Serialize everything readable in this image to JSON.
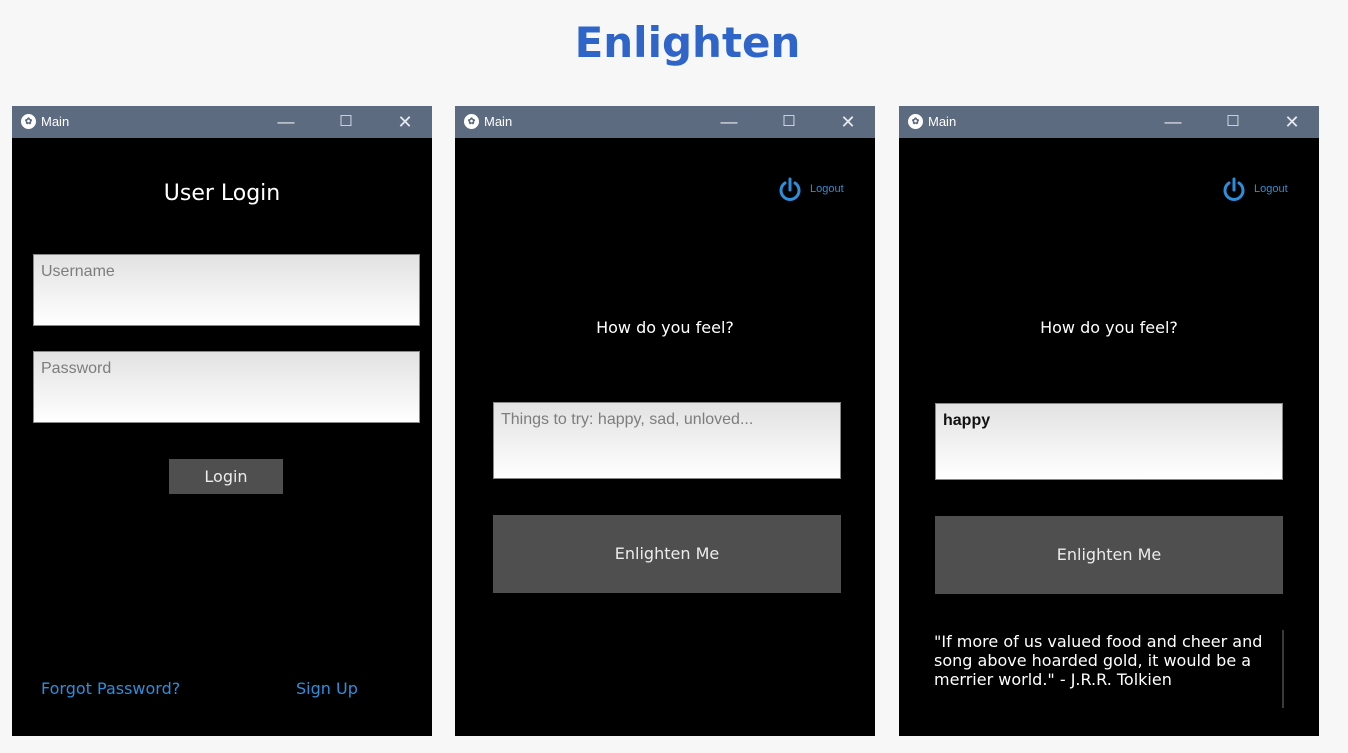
{
  "page": {
    "title": "Enlighten"
  },
  "windows": {
    "login": {
      "title": "Main",
      "heading": "User Login",
      "username_placeholder": "Username",
      "password_placeholder": "Password",
      "login_button": "Login",
      "forgot_link": "Forgot Password?",
      "signup_link": "Sign Up"
    },
    "ask": {
      "title": "Main",
      "logout_label": "Logout",
      "prompt": "How do you feel?",
      "input_placeholder": "Things to try: happy, sad, unloved...",
      "button": "Enlighten Me"
    },
    "result": {
      "title": "Main",
      "logout_label": "Logout",
      "prompt": "How do you feel?",
      "input_value": "happy",
      "button": "Enlighten Me",
      "quote": "\"If more of us valued food and cheer and song above hoarded gold, it would be a merrier world.\" - J.R.R. Tolkien"
    }
  },
  "icons": {
    "app": "kivy-app-icon",
    "minimize": "minimize-icon",
    "maximize": "maximize-icon",
    "close": "close-icon",
    "logout": "power-icon"
  },
  "colors": {
    "title_blue": "#2f64c8",
    "link_blue": "#2d8edb",
    "titlebar": "#5d6b80",
    "button_gray": "#4f4f4f"
  }
}
